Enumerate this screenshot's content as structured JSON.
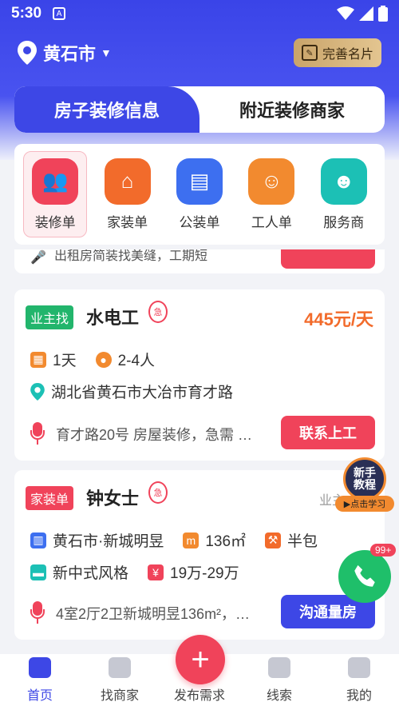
{
  "status_bar": {
    "time": "5:30",
    "notif_icon": "A"
  },
  "header": {
    "city": "黄石市",
    "card_button": "完善名片"
  },
  "tabs": [
    {
      "label": "房子装修信息",
      "active": true
    },
    {
      "label": "附近装修商家",
      "active": false
    }
  ],
  "categories": [
    {
      "label": "装修单",
      "icon": "team-house-icon",
      "color": "#f0435a"
    },
    {
      "label": "家装单",
      "icon": "house-icon",
      "color": "#f26b2b"
    },
    {
      "label": "公装单",
      "icon": "shop-icon",
      "color": "#3d6ff0"
    },
    {
      "label": "工人单",
      "icon": "worker-icon",
      "color": "#f28a2f"
    },
    {
      "label": "服务商",
      "icon": "engineer-icon",
      "color": "#1cc0b5"
    }
  ],
  "partial_card": {
    "text": "出租房简装找美缝，工期短"
  },
  "job1": {
    "tag": "业主找",
    "title": "水电工",
    "urgent": "急",
    "price": "445元/天",
    "duration": "1天",
    "people": "2-4人",
    "address": "湖北省黄石市大冶市育才路",
    "desc": "育才路20号 房屋装修，急需 …",
    "button": "联系上工"
  },
  "job2": {
    "tag": "家装单",
    "title": "钟女士",
    "urgent": "急",
    "role": "业主",
    "community": "黄石市·新城明昱",
    "area": "136㎡",
    "pack": "半包",
    "style": "新中式风格",
    "budget": "19万-29万",
    "desc": "4室2厅2卫新城明昱136m²，…",
    "button": "沟通量房"
  },
  "tutorial": {
    "line1": "新手",
    "line2": "教程",
    "label": "▶点击学习"
  },
  "phone_badge": "99+",
  "bottom_nav": [
    {
      "label": "首页",
      "active": true
    },
    {
      "label": "找商家",
      "active": false
    },
    {
      "label": "发布需求",
      "active": false
    },
    {
      "label": "线索",
      "active": false
    },
    {
      "label": "我的",
      "active": false
    }
  ]
}
